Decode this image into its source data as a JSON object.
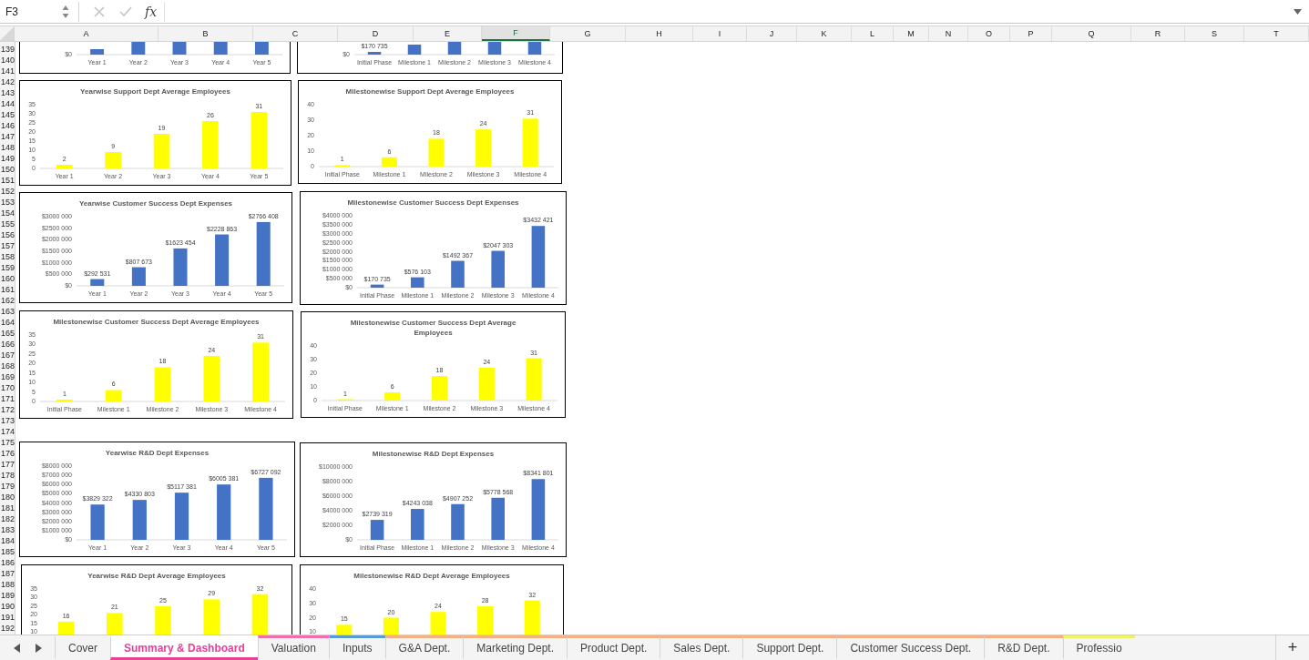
{
  "formula_bar": {
    "name_box": "F3",
    "function_label": "fx"
  },
  "columns": [
    {
      "label": "A",
      "selected": false
    },
    {
      "label": "B",
      "selected": false
    },
    {
      "label": "C",
      "selected": false
    },
    {
      "label": "D",
      "selected": false
    },
    {
      "label": "E",
      "selected": false
    },
    {
      "label": "F",
      "selected": true
    },
    {
      "label": "G",
      "selected": false
    },
    {
      "label": "H",
      "selected": false
    },
    {
      "label": "I",
      "selected": false
    },
    {
      "label": "J",
      "selected": false
    },
    {
      "label": "K",
      "selected": false
    },
    {
      "label": "L",
      "selected": false
    },
    {
      "label": "M",
      "selected": false
    },
    {
      "label": "N",
      "selected": false
    },
    {
      "label": "O",
      "selected": false
    },
    {
      "label": "P",
      "selected": false
    },
    {
      "label": "Q",
      "selected": false
    },
    {
      "label": "R",
      "selected": false
    },
    {
      "label": "S",
      "selected": false
    },
    {
      "label": "T",
      "selected": false
    }
  ],
  "rows": [
    "139",
    "140",
    "141",
    "142",
    "143",
    "144",
    "145",
    "146",
    "147",
    "148",
    "149",
    "150",
    "151",
    "152",
    "153",
    "154",
    "155",
    "156",
    "157",
    "158",
    "159",
    "160",
    "161",
    "162",
    "163",
    "164",
    "165",
    "166",
    "167",
    "168",
    "169",
    "170",
    "171",
    "172",
    "173",
    "174",
    "175",
    "176",
    "177",
    "178",
    "179",
    "180",
    "181",
    "182",
    "183",
    "184",
    "185",
    "186",
    "187",
    "188",
    "189",
    "190",
    "191",
    "192"
  ],
  "charts": [
    {
      "kind": "clipped",
      "tick_label": "$0",
      "categories": [
        "Year 1",
        "Year 2",
        "Year 3",
        "Year 4",
        "Year 5"
      ]
    },
    {
      "kind": "clipped",
      "tick_label": "$0",
      "data_label": "$170 735",
      "categories": [
        "Initial Phase",
        "Milestone 1",
        "Milestone 2",
        "Milestone 3",
        "Milestone 4"
      ]
    },
    {
      "kind": "chart",
      "chart_data": {
        "type": "bar",
        "title": "Yearwise Support Dept Average Employees",
        "categories": [
          "Year 1",
          "Year 2",
          "Year 3",
          "Year 4",
          "Year 5"
        ],
        "series": [
          {
            "color": "#ffff00",
            "values": [
              2,
              9,
              19,
              26,
              31
            ]
          }
        ],
        "ylim": [
          0,
          35
        ],
        "yticks": [
          0,
          5,
          10,
          15,
          20,
          25,
          30,
          35
        ],
        "data_labels": true
      }
    },
    {
      "kind": "chart",
      "chart_data": {
        "type": "bar",
        "title": "Milestonewise Support Dept Average Employees",
        "categories": [
          "Initial Phase",
          "Milestone 1",
          "Milestone 2",
          "Milestone 3",
          "Milestone 4"
        ],
        "series": [
          {
            "color": "#ffff00",
            "values": [
              1,
              6,
              18,
              24,
              31
            ]
          }
        ],
        "ylim": [
          0,
          40
        ],
        "yticks": [
          0,
          10,
          20,
          30,
          40
        ],
        "data_labels": true
      }
    },
    {
      "kind": "chart",
      "chart_data": {
        "type": "bar",
        "title": "Yearwise Customer Success Dept Expenses",
        "categories": [
          "Year 1",
          "Year 2",
          "Year 3",
          "Year 4",
          "Year 5"
        ],
        "series": [
          {
            "color": "#4472c4",
            "values": [
              292531,
              807673,
              1623454,
              2228863,
              2766408
            ]
          }
        ],
        "ylim": [
          0,
          3000000
        ],
        "yticks": [
          {
            "value": 0,
            "label": "$0"
          },
          {
            "value": 500000,
            "label": "$500 000"
          },
          {
            "value": 1000000,
            "label": "$1000 000"
          },
          {
            "value": 1500000,
            "label": "$1500 000"
          },
          {
            "value": 2000000,
            "label": "$2000 000"
          },
          {
            "value": 2500000,
            "label": "$2500 000"
          },
          {
            "value": 3000000,
            "label": "$3000 000"
          }
        ],
        "value_labels": [
          "$292 531",
          "$807 673",
          "$1623 454",
          "$2228 863",
          "$2766 408"
        ]
      }
    },
    {
      "kind": "chart",
      "chart_data": {
        "type": "bar",
        "title": "Milestonewise Customer Success Dept Expenses",
        "categories": [
          "Initial Phase",
          "Milestone 1",
          "Milestone 2",
          "Milestone 3",
          "Milestone 4"
        ],
        "series": [
          {
            "color": "#4472c4",
            "values": [
              170735,
              576103,
              1492367,
              2047303,
              3432421
            ]
          }
        ],
        "ylim": [
          0,
          4000000
        ],
        "yticks": [
          {
            "value": 0,
            "label": "$0"
          },
          {
            "value": 500000,
            "label": "$500 000"
          },
          {
            "value": 1000000,
            "label": "$1000 000"
          },
          {
            "value": 1500000,
            "label": "$1500 000"
          },
          {
            "value": 2000000,
            "label": "$2000 000"
          },
          {
            "value": 2500000,
            "label": "$2500 000"
          },
          {
            "value": 3000000,
            "label": "$3000 000"
          },
          {
            "value": 3500000,
            "label": "$3500 000"
          },
          {
            "value": 4000000,
            "label": "$4000 000"
          }
        ],
        "value_labels": [
          "$170 735",
          "$576 103",
          "$1492 367",
          "$2047 303",
          "$3432 421"
        ]
      }
    },
    {
      "kind": "chart",
      "chart_data": {
        "type": "bar",
        "title": "Milestonewise Customer Success Dept Average Employees",
        "categories": [
          "Initial Phase",
          "Milestone 1",
          "Milestone 2",
          "Milestone 3",
          "Milestone 4"
        ],
        "series": [
          {
            "color": "#ffff00",
            "values": [
              1,
              6,
              18,
              24,
              31
            ]
          }
        ],
        "ylim": [
          0,
          35
        ],
        "yticks": [
          0,
          5,
          10,
          15,
          20,
          25,
          30,
          35
        ],
        "data_labels": true
      }
    },
    {
      "kind": "chart",
      "chart_data": {
        "type": "bar",
        "title": "Milestonewise Customer Success Dept Average Employees",
        "categories": [
          "Initial Phase",
          "Milestone 1",
          "Milestone 2",
          "Milestone 3",
          "Milestone 4"
        ],
        "series": [
          {
            "color": "#ffff00",
            "values": [
              1,
              6,
              18,
              24,
              31
            ]
          }
        ],
        "ylim": [
          0,
          40
        ],
        "yticks": [
          0,
          10,
          20,
          30,
          40
        ],
        "data_labels": true
      }
    },
    {
      "kind": "chart",
      "chart_data": {
        "type": "bar",
        "title": "Yearwise R&D Dept Expenses",
        "categories": [
          "Year 1",
          "Year 2",
          "Year 3",
          "Year 4",
          "Year 5"
        ],
        "series": [
          {
            "color": "#4472c4",
            "values": [
              3829322,
              4330803,
              5117381,
              6005381,
              6727092
            ]
          }
        ],
        "ylim": [
          0,
          8000000
        ],
        "yticks": [
          {
            "value": 0,
            "label": "$0"
          },
          {
            "value": 1000000,
            "label": "$1000 000"
          },
          {
            "value": 2000000,
            "label": "$2000 000"
          },
          {
            "value": 3000000,
            "label": "$3000 000"
          },
          {
            "value": 4000000,
            "label": "$4000 000"
          },
          {
            "value": 5000000,
            "label": "$5000 000"
          },
          {
            "value": 6000000,
            "label": "$6000 000"
          },
          {
            "value": 7000000,
            "label": "$7000 000"
          },
          {
            "value": 8000000,
            "label": "$8000 000"
          }
        ],
        "value_labels": [
          "$3829 322",
          "$4330 803",
          "$5117 381",
          "$6005 381",
          "$6727 092"
        ]
      }
    },
    {
      "kind": "chart",
      "chart_data": {
        "type": "bar",
        "title": "Milestonewise R&D Dept Expenses",
        "categories": [
          "Initial Phase",
          "Milestone 1",
          "Milestone 2",
          "Milestone 3",
          "Milestone 4"
        ],
        "series": [
          {
            "color": "#4472c4",
            "values": [
              2739319,
              4243038,
              4907252,
              5778568,
              8341801
            ]
          }
        ],
        "ylim": [
          0,
          10000000
        ],
        "yticks": [
          {
            "value": 0,
            "label": "$0"
          },
          {
            "value": 2000000,
            "label": "$2000 000"
          },
          {
            "value": 4000000,
            "label": "$4000 000"
          },
          {
            "value": 6000000,
            "label": "$6000 000"
          },
          {
            "value": 8000000,
            "label": "$8000 000"
          },
          {
            "value": 10000000,
            "label": "$10000 000"
          }
        ],
        "value_labels": [
          "$2739 319",
          "$4243 038",
          "$4907 252",
          "$5778 568",
          "$8341 801"
        ]
      }
    },
    {
      "kind": "chart",
      "chart_data": {
        "type": "bar",
        "title": "Yearwise R&D Dept Average Employees",
        "series": [
          {
            "color": "#ffff00",
            "values": [
              16,
              21,
              25,
              29,
              32
            ]
          }
        ],
        "ylim": [
          0,
          35
        ],
        "yticks": [
          10,
          15,
          20,
          25,
          30,
          35
        ],
        "data_labels": true
      }
    },
    {
      "kind": "chart",
      "chart_data": {
        "type": "bar",
        "title": "Milestonewise R&D Dept Average Employees",
        "series": [
          {
            "color": "#ffff00",
            "values": [
              15,
              20,
              24,
              28,
              32
            ]
          }
        ],
        "ylim": [
          0,
          40
        ],
        "yticks": [
          10,
          20,
          30,
          40
        ],
        "data_labels": true
      }
    }
  ],
  "sheet_tabs": [
    {
      "label": "Cover",
      "selected": false
    },
    {
      "label": "Summary & Dashboard",
      "selected": true,
      "color": "#e8409a"
    },
    {
      "label": "Valuation",
      "selected": false,
      "color": "#f06eaa"
    },
    {
      "label": "Inputs",
      "selected": false,
      "color": "#5b9bd5"
    },
    {
      "label": "G&A Dept.",
      "selected": false,
      "color": "#f4b183"
    },
    {
      "label": "Marketing Dept.",
      "selected": false,
      "color": "#f4b183"
    },
    {
      "label": "Product Dept.",
      "selected": false,
      "color": "#f4b183"
    },
    {
      "label": "Sales Dept.",
      "selected": false,
      "color": "#f4b183"
    },
    {
      "label": "Support Dept.",
      "selected": false,
      "color": "#f4b183"
    },
    {
      "label": "Customer Success Dept.",
      "selected": false,
      "color": "#f4b183"
    },
    {
      "label": "R&D Dept.",
      "selected": false,
      "color": "#f4b183"
    },
    {
      "label": "Professio",
      "selected": false,
      "color": "#eef266"
    }
  ],
  "add_sheet": "+"
}
